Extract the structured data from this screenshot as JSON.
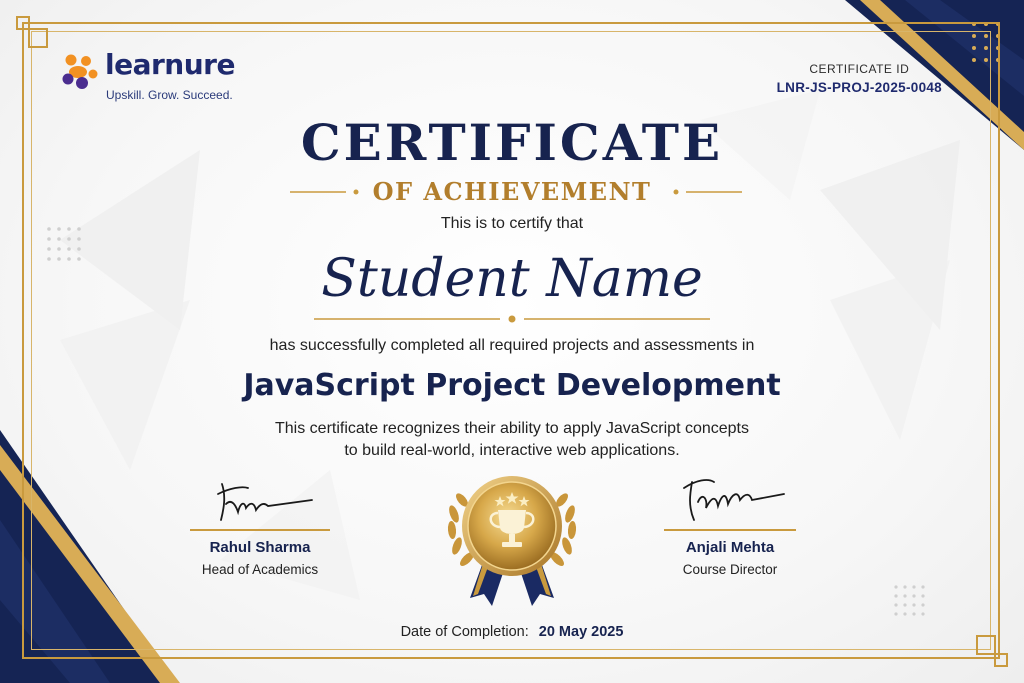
{
  "brand": {
    "name": "learnure",
    "tagline": "Upskill. Grow. Succeed."
  },
  "certificate_id": {
    "label": "CERTIFICATE ID",
    "value": "LNR-JS-PROJ-2025-0048"
  },
  "heading": {
    "title": "CERTIFICATE",
    "subtitle": "OF ACHIEVEMENT"
  },
  "body": {
    "intro": "This is to certify that",
    "recipient": "Student Name",
    "completion_text": "has successfully completed all required projects and assessments in",
    "course": "JavaScript Project Development",
    "recognition_line1": "This certificate recognizes their ability to apply JavaScript concepts",
    "recognition_line2": "to build real-world, interactive web applications."
  },
  "signatories": [
    {
      "name": "Rahul Sharma",
      "role": "Head of Academics"
    },
    {
      "name": "Anjali Mehta",
      "role": "Course Director"
    }
  ],
  "completion": {
    "label": "Date of Completion:",
    "date": "20 May 2025"
  },
  "colors": {
    "navy": "#17234f",
    "gold": "#c99a3e",
    "logo_orange": "#f29122",
    "logo_purple": "#4b2d8f"
  },
  "icons": [
    "trophy-icon",
    "star-icon",
    "laurel-icon",
    "ribbon-icon",
    "logo-icon"
  ]
}
